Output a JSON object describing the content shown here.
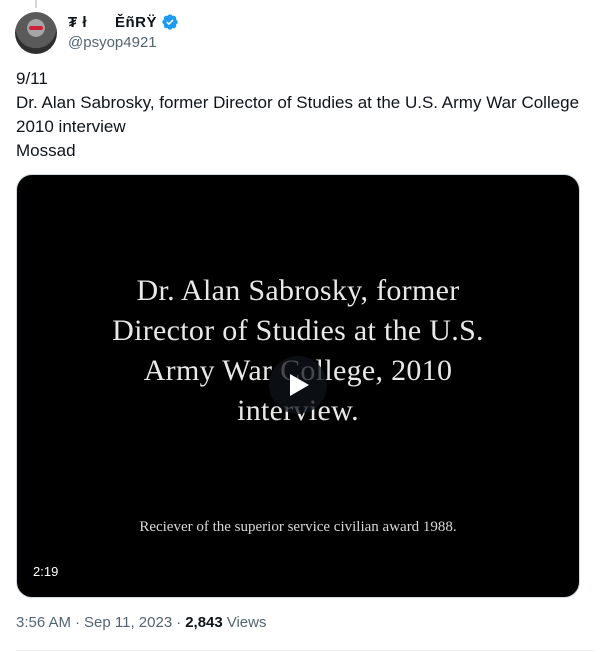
{
  "author": {
    "display_name": "₮ ł      ĚñRŸ",
    "handle": "@psyop4921",
    "verified_icon": "verified-badge-icon",
    "verified_color": "#1d9bf0"
  },
  "tweet": {
    "lines": [
      "9/11",
      "Dr. Alan Sabrosky, former Director of Studies at the U.S. Army War College 2010 interview",
      "Mossad"
    ]
  },
  "video": {
    "caption_lines": [
      "Dr. Alan Sabrosky, former",
      "Director of Studies at the U.S.",
      "Army War College, 2010",
      "interview."
    ],
    "subcaption": "Reciever of the superior service civilian award 1988.",
    "duration": "2:19",
    "play_icon": "play-icon"
  },
  "meta": {
    "time": "3:56 AM",
    "separator": "·",
    "date": "Sep 11, 2023",
    "views_count": "2,843",
    "views_label": "Views"
  },
  "colors": {
    "text_primary": "#0f1419",
    "text_secondary": "#536471",
    "border": "#cfd9de"
  }
}
